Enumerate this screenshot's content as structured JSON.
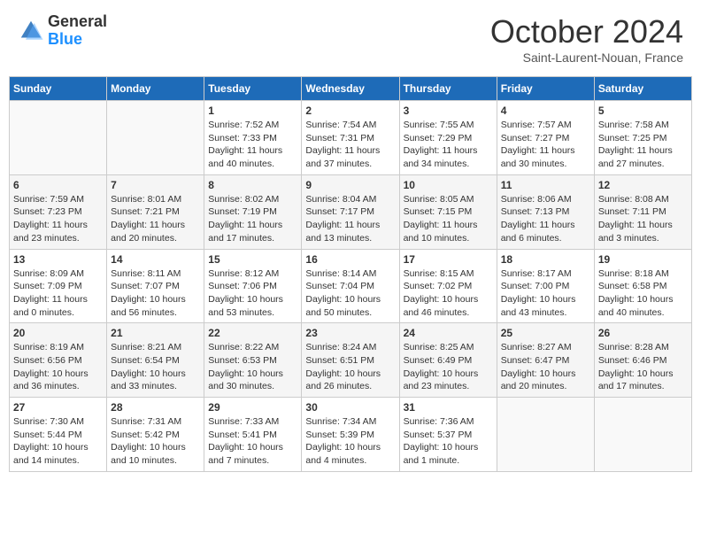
{
  "header": {
    "logo_general": "General",
    "logo_blue": "Blue",
    "month_title": "October 2024",
    "subtitle": "Saint-Laurent-Nouan, France"
  },
  "weekdays": [
    "Sunday",
    "Monday",
    "Tuesday",
    "Wednesday",
    "Thursday",
    "Friday",
    "Saturday"
  ],
  "weeks": [
    [
      {
        "day": "",
        "info": ""
      },
      {
        "day": "",
        "info": ""
      },
      {
        "day": "1",
        "info": "Sunrise: 7:52 AM\nSunset: 7:33 PM\nDaylight: 11 hours and 40 minutes."
      },
      {
        "day": "2",
        "info": "Sunrise: 7:54 AM\nSunset: 7:31 PM\nDaylight: 11 hours and 37 minutes."
      },
      {
        "day": "3",
        "info": "Sunrise: 7:55 AM\nSunset: 7:29 PM\nDaylight: 11 hours and 34 minutes."
      },
      {
        "day": "4",
        "info": "Sunrise: 7:57 AM\nSunset: 7:27 PM\nDaylight: 11 hours and 30 minutes."
      },
      {
        "day": "5",
        "info": "Sunrise: 7:58 AM\nSunset: 7:25 PM\nDaylight: 11 hours and 27 minutes."
      }
    ],
    [
      {
        "day": "6",
        "info": "Sunrise: 7:59 AM\nSunset: 7:23 PM\nDaylight: 11 hours and 23 minutes."
      },
      {
        "day": "7",
        "info": "Sunrise: 8:01 AM\nSunset: 7:21 PM\nDaylight: 11 hours and 20 minutes."
      },
      {
        "day": "8",
        "info": "Sunrise: 8:02 AM\nSunset: 7:19 PM\nDaylight: 11 hours and 17 minutes."
      },
      {
        "day": "9",
        "info": "Sunrise: 8:04 AM\nSunset: 7:17 PM\nDaylight: 11 hours and 13 minutes."
      },
      {
        "day": "10",
        "info": "Sunrise: 8:05 AM\nSunset: 7:15 PM\nDaylight: 11 hours and 10 minutes."
      },
      {
        "day": "11",
        "info": "Sunrise: 8:06 AM\nSunset: 7:13 PM\nDaylight: 11 hours and 6 minutes."
      },
      {
        "day": "12",
        "info": "Sunrise: 8:08 AM\nSunset: 7:11 PM\nDaylight: 11 hours and 3 minutes."
      }
    ],
    [
      {
        "day": "13",
        "info": "Sunrise: 8:09 AM\nSunset: 7:09 PM\nDaylight: 11 hours and 0 minutes."
      },
      {
        "day": "14",
        "info": "Sunrise: 8:11 AM\nSunset: 7:07 PM\nDaylight: 10 hours and 56 minutes."
      },
      {
        "day": "15",
        "info": "Sunrise: 8:12 AM\nSunset: 7:06 PM\nDaylight: 10 hours and 53 minutes."
      },
      {
        "day": "16",
        "info": "Sunrise: 8:14 AM\nSunset: 7:04 PM\nDaylight: 10 hours and 50 minutes."
      },
      {
        "day": "17",
        "info": "Sunrise: 8:15 AM\nSunset: 7:02 PM\nDaylight: 10 hours and 46 minutes."
      },
      {
        "day": "18",
        "info": "Sunrise: 8:17 AM\nSunset: 7:00 PM\nDaylight: 10 hours and 43 minutes."
      },
      {
        "day": "19",
        "info": "Sunrise: 8:18 AM\nSunset: 6:58 PM\nDaylight: 10 hours and 40 minutes."
      }
    ],
    [
      {
        "day": "20",
        "info": "Sunrise: 8:19 AM\nSunset: 6:56 PM\nDaylight: 10 hours and 36 minutes."
      },
      {
        "day": "21",
        "info": "Sunrise: 8:21 AM\nSunset: 6:54 PM\nDaylight: 10 hours and 33 minutes."
      },
      {
        "day": "22",
        "info": "Sunrise: 8:22 AM\nSunset: 6:53 PM\nDaylight: 10 hours and 30 minutes."
      },
      {
        "day": "23",
        "info": "Sunrise: 8:24 AM\nSunset: 6:51 PM\nDaylight: 10 hours and 26 minutes."
      },
      {
        "day": "24",
        "info": "Sunrise: 8:25 AM\nSunset: 6:49 PM\nDaylight: 10 hours and 23 minutes."
      },
      {
        "day": "25",
        "info": "Sunrise: 8:27 AM\nSunset: 6:47 PM\nDaylight: 10 hours and 20 minutes."
      },
      {
        "day": "26",
        "info": "Sunrise: 8:28 AM\nSunset: 6:46 PM\nDaylight: 10 hours and 17 minutes."
      }
    ],
    [
      {
        "day": "27",
        "info": "Sunrise: 7:30 AM\nSunset: 5:44 PM\nDaylight: 10 hours and 14 minutes."
      },
      {
        "day": "28",
        "info": "Sunrise: 7:31 AM\nSunset: 5:42 PM\nDaylight: 10 hours and 10 minutes."
      },
      {
        "day": "29",
        "info": "Sunrise: 7:33 AM\nSunset: 5:41 PM\nDaylight: 10 hours and 7 minutes."
      },
      {
        "day": "30",
        "info": "Sunrise: 7:34 AM\nSunset: 5:39 PM\nDaylight: 10 hours and 4 minutes."
      },
      {
        "day": "31",
        "info": "Sunrise: 7:36 AM\nSunset: 5:37 PM\nDaylight: 10 hours and 1 minute."
      },
      {
        "day": "",
        "info": ""
      },
      {
        "day": "",
        "info": ""
      }
    ]
  ]
}
